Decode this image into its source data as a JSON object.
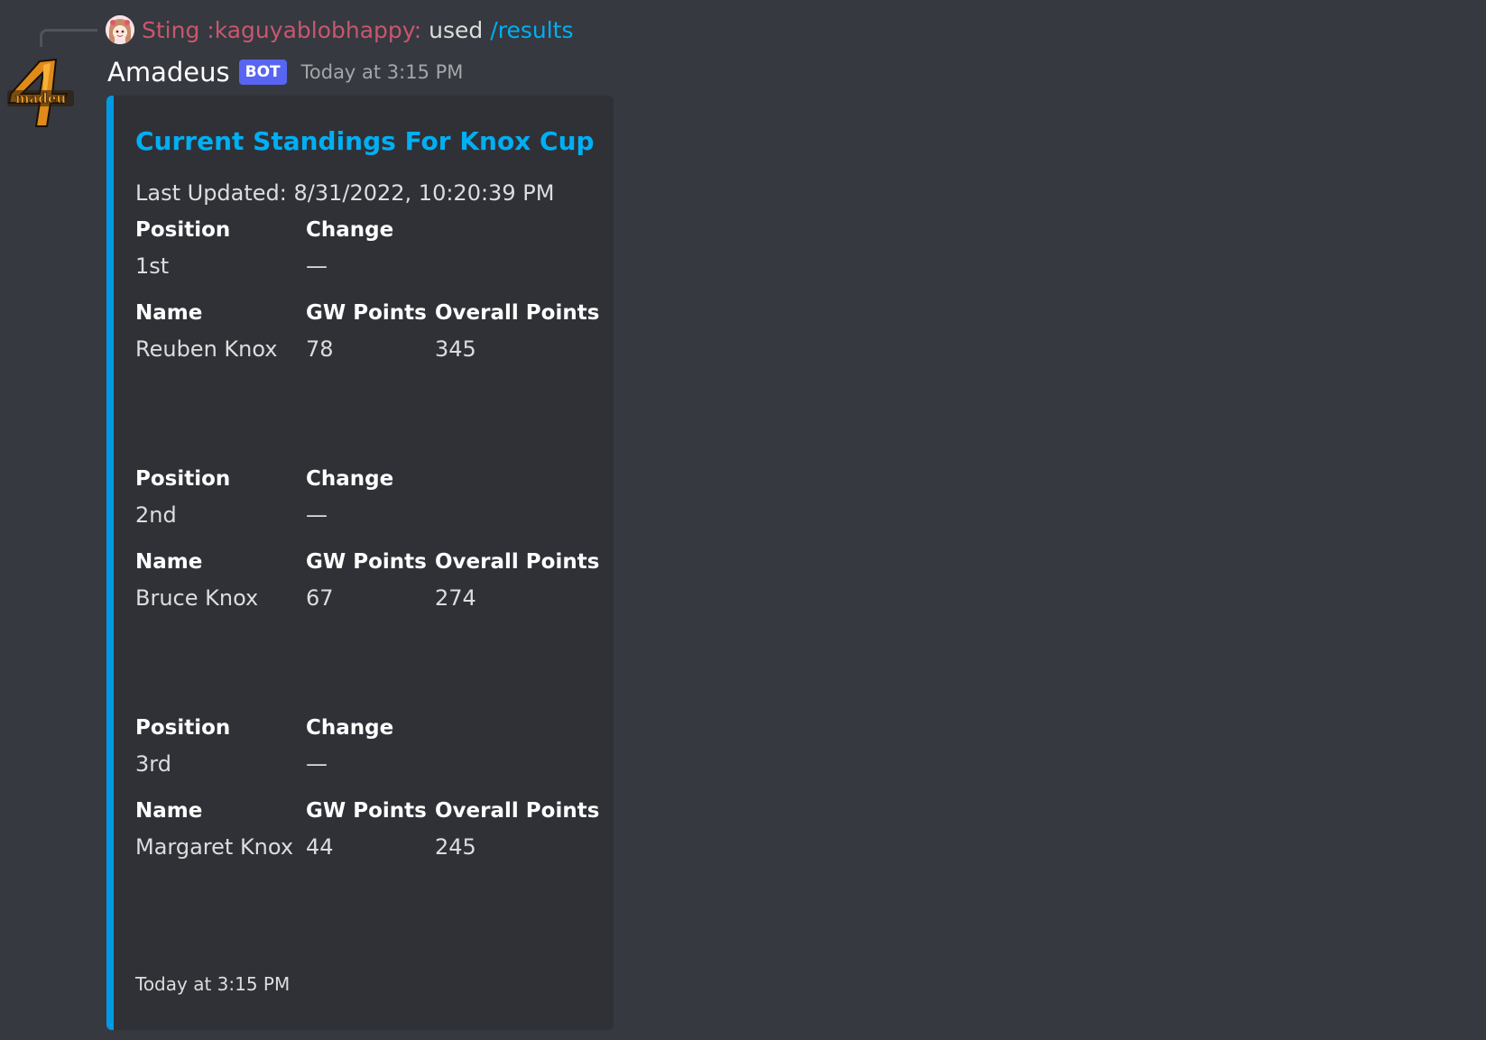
{
  "reply": {
    "user": "Sting :kaguyablobhappy:",
    "used_text": "used",
    "command": "/results",
    "avatar_icon": "anime-girl-avatar"
  },
  "message": {
    "username": "Amadeus",
    "bot_tag": "BOT",
    "timestamp": "Today at 3:15 PM",
    "avatar_icon": "amadeus-logo"
  },
  "embed": {
    "accent_color": "#0099e6",
    "title": "Current Standings For Knox Cup",
    "description": "Last Updated: 8/31/2022, 10:20:39 PM",
    "standings": [
      {
        "position_label": "Position",
        "position": "1st",
        "change_label": "Change",
        "change": "—",
        "name_label": "Name",
        "name": "Reuben Knox",
        "gw_label": "GW Points",
        "gw_points": "78",
        "overall_label": "Overall Points",
        "overall_points": "345"
      },
      {
        "position_label": "Position",
        "position": "2nd",
        "change_label": "Change",
        "change": "—",
        "name_label": "Name",
        "name": "Bruce Knox",
        "gw_label": "GW Points",
        "gw_points": "67",
        "overall_label": "Overall Points",
        "overall_points": "274"
      },
      {
        "position_label": "Position",
        "position": "3rd",
        "change_label": "Change",
        "change": "—",
        "name_label": "Name",
        "name": "Margaret Knox",
        "gw_label": "GW Points",
        "gw_points": "44",
        "overall_label": "Overall Points",
        "overall_points": "245"
      }
    ],
    "footer": "Today at 3:15 PM"
  }
}
